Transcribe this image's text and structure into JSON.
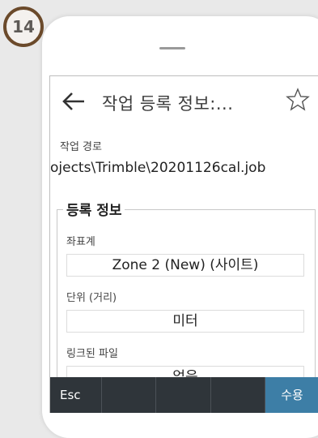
{
  "step_badge": "14",
  "header": {
    "back_icon": "arrow-left",
    "title": "작업 등록 정보:...",
    "favorite_icon": "star-outline"
  },
  "job_path": {
    "label": "작업 경로",
    "value": "ojects\\Trimble\\20201126cal.job"
  },
  "registration": {
    "legend": "등록 정보",
    "coordinate_system": {
      "label": "좌표계",
      "value": "Zone 2 (New) (사이트)"
    },
    "units": {
      "label": "단위 (거리)",
      "value": "미터"
    },
    "linked_files": {
      "label": "링크된 파일",
      "value": "없음"
    }
  },
  "softkeys": {
    "esc": "Esc",
    "accept": "수용"
  },
  "colors": {
    "badge_border": "#6b4a2b",
    "softkey_bar": "#2f353a",
    "accept_button": "#3d7ea6"
  }
}
